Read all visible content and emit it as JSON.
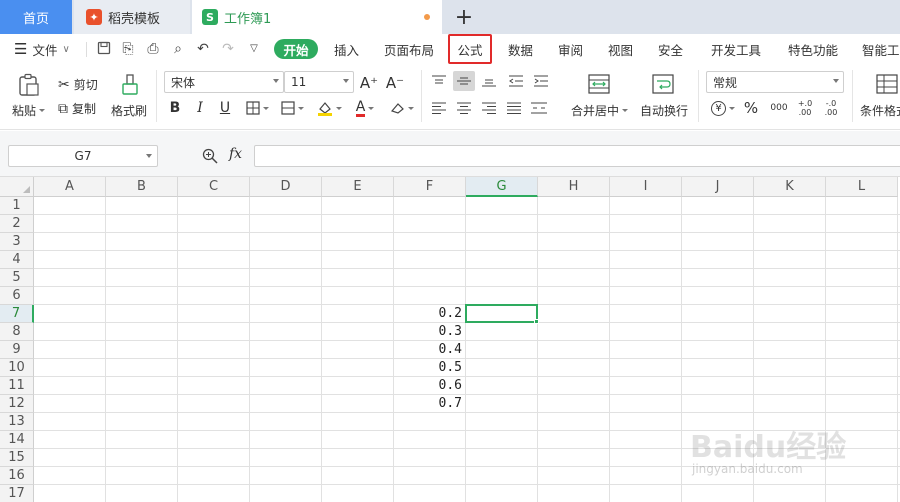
{
  "tabs": {
    "home": "首页",
    "docer": "稻壳模板",
    "book": "工作簿1",
    "add": "+"
  },
  "menu": {
    "file": "文件",
    "items": [
      "开始",
      "插入",
      "页面布局",
      "公式",
      "数据",
      "审阅",
      "视图",
      "安全",
      "开发工具",
      "特色功能",
      "智能工具"
    ]
  },
  "ribbon": {
    "paste": "粘贴",
    "cut": "剪切",
    "copy": "复制",
    "format_painter": "格式刷",
    "font_name": "宋体",
    "font_size": "11",
    "merge_center": "合并居中",
    "wrap_text": "自动换行",
    "number_format": "常规",
    "conditional_format": "条件格式",
    "bold": "B",
    "italic": "I",
    "underline": "U",
    "font_color_letter": "A",
    "grow_font": "A⁺",
    "shrink_font": "A⁻",
    "currency_symbol": "¥",
    "percent_symbol": "%",
    "thousands_symbol": "000",
    "increase_decimal": "+.0 .00",
    "decrease_decimal": "-.0 .00"
  },
  "formula_bar": {
    "name_box": "G7",
    "fx": "fx",
    "content": ""
  },
  "sheet": {
    "columns": [
      "A",
      "B",
      "C",
      "D",
      "E",
      "F",
      "G",
      "H",
      "I",
      "J",
      "K",
      "L"
    ],
    "rows": [
      "1",
      "2",
      "3",
      "4",
      "5",
      "6",
      "7",
      "8",
      "9",
      "10",
      "11",
      "12",
      "13",
      "14",
      "15",
      "16",
      "17"
    ],
    "active_column": "G",
    "active_row": "7",
    "values_col_F": [
      "0.2",
      "0.3",
      "0.4",
      "0.5",
      "0.6",
      "0.7"
    ]
  },
  "watermark": {
    "logo": "Baidu经验",
    "url": "jingyan.baidu.com"
  },
  "colors": {
    "accent_green": "#2eab5f",
    "tab_blue": "#4a8ff0",
    "highlight_red": "#e12a2a"
  }
}
